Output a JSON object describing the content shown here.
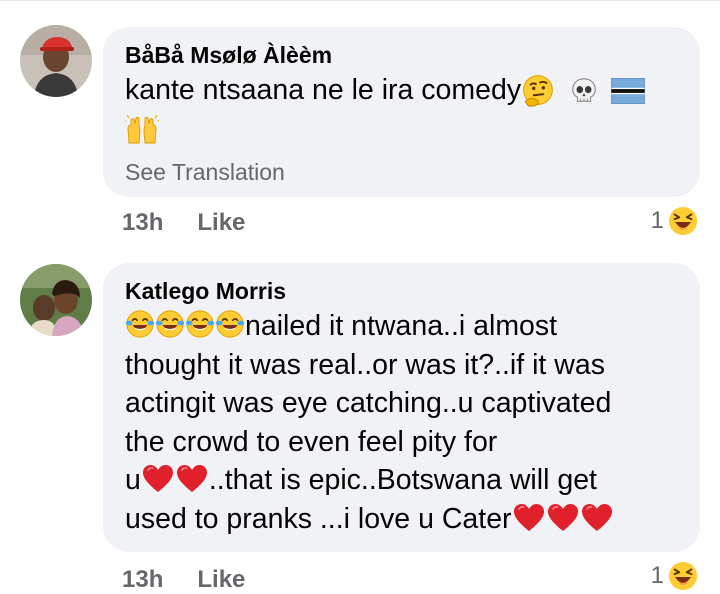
{
  "comments": [
    {
      "author": "BåBå Msølø Àlèèm",
      "text_prefix": "kante ntsaana ne le ira comedy",
      "emoji_sequence": [
        "thinking-face",
        "skull",
        "botswana-flag",
        "raising-hands"
      ],
      "see_translation": "See Translation",
      "time": "13h",
      "like_label": "Like",
      "reaction_count": "1",
      "reaction_icon": "laughing-face"
    },
    {
      "author": "Katlego Morris",
      "line1_text": "nailed it ntwana..i almost",
      "line2_text": "thought it was real..or was it?..if it was",
      "line3_text": "actingit was eye catching..u captivated",
      "line4_text": "the crowd to even feel pity for",
      "line5_prefix": "u",
      "line5_suffix": "..that is epic..Botswana will get",
      "line6_text": "used to pranks ...i love u Cater",
      "leading_emojis": [
        "tears-of-joy",
        "tears-of-joy",
        "tears-of-joy",
        "tears-of-joy"
      ],
      "time": "13h",
      "like_label": "Like",
      "reaction_count": "1",
      "reaction_icon": "laughing-face"
    }
  ],
  "colors": {
    "bubble": "#f0f2f5",
    "secondary_text": "#65676b",
    "heart": "#e0202a",
    "emoji_yellow": "#ffcc33"
  }
}
